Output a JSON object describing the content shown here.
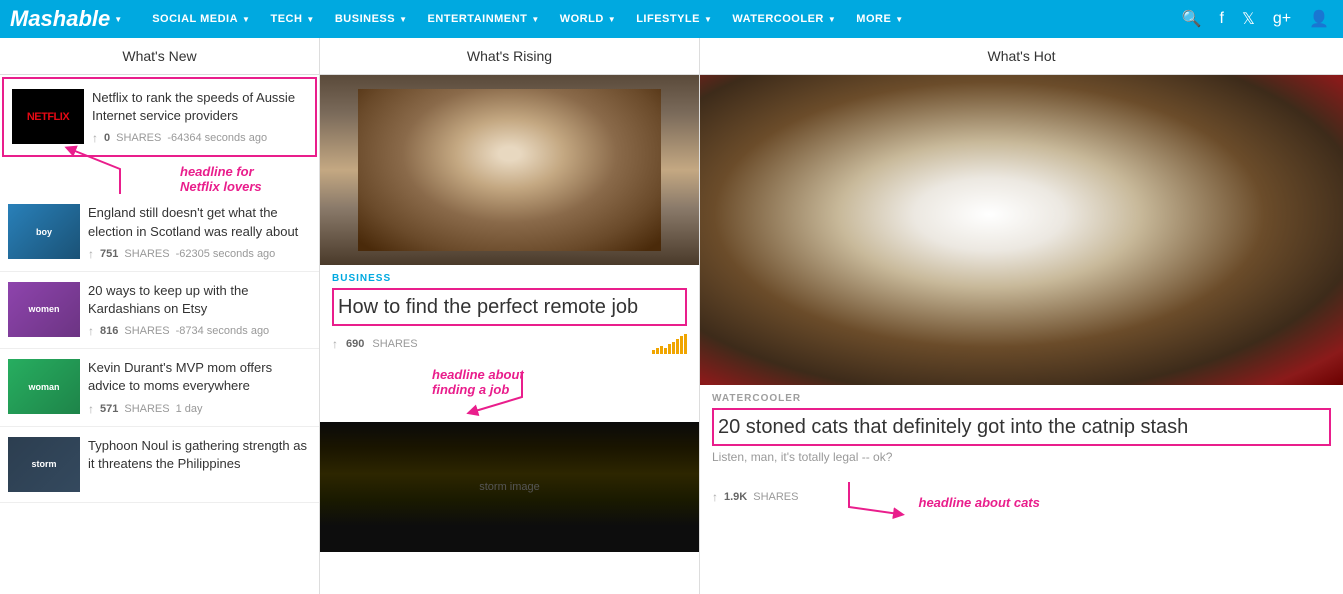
{
  "nav": {
    "logo": "Mashable",
    "items": [
      {
        "label": "SOCIAL MEDIA",
        "id": "social-media"
      },
      {
        "label": "TECH",
        "id": "tech"
      },
      {
        "label": "BUSINESS",
        "id": "business"
      },
      {
        "label": "ENTERTAINMENT",
        "id": "entertainment"
      },
      {
        "label": "WORLD",
        "id": "world"
      },
      {
        "label": "LIFESTYLE",
        "id": "lifestyle"
      },
      {
        "label": "WATERCOOLER",
        "id": "watercooler"
      },
      {
        "label": "MORE",
        "id": "more"
      }
    ]
  },
  "columns": {
    "whats_new": "What's New",
    "whats_rising": "What's Rising",
    "whats_hot": "What's Hot"
  },
  "news_items": [
    {
      "id": "item1",
      "thumb_label": "NETFLIX",
      "title": "Netflix to rank the speeds of Aussie Internet service providers",
      "shares": "0",
      "shares_label": "SHARES",
      "time": "-64364 seconds ago",
      "highlighted": true
    },
    {
      "id": "item2",
      "thumb_label": "boy",
      "title": "England still doesn't get what the election in Scotland was really about",
      "shares": "751",
      "shares_label": "SHARES",
      "time": "-62305 seconds ago",
      "highlighted": false
    },
    {
      "id": "item3",
      "thumb_label": "women",
      "title": "20 ways to keep up with the Kardashians on Etsy",
      "shares": "816",
      "shares_label": "SHARES",
      "time": "-8734 seconds ago",
      "highlighted": false
    },
    {
      "id": "item4",
      "thumb_label": "woman",
      "title": "Kevin Durant's MVP mom offers advice to moms everywhere",
      "shares": "571",
      "shares_label": "SHARES",
      "time": "1 day",
      "highlighted": false
    },
    {
      "id": "item5",
      "thumb_label": "storm",
      "title": "Typhoon Noul is gathering strength as it threatens the Philippines",
      "shares": "",
      "shares_label": "",
      "time": "",
      "highlighted": false
    }
  ],
  "rising": {
    "category": "BUSINESS",
    "title": "How to find the perfect remote job",
    "shares": "690",
    "shares_label": "SHARES"
  },
  "hot": {
    "category": "WATERCOOLER",
    "title": "20 stoned cats that definitely got into the catnip stash",
    "description": "Listen, man, it's totally legal -- ok?",
    "shares": "1.9K",
    "shares_label": "SHARES"
  },
  "annotations": {
    "netflix": "headline for\nNetflix lovers",
    "job": "headline about\nfinding a job",
    "cats": "headline about cats"
  }
}
